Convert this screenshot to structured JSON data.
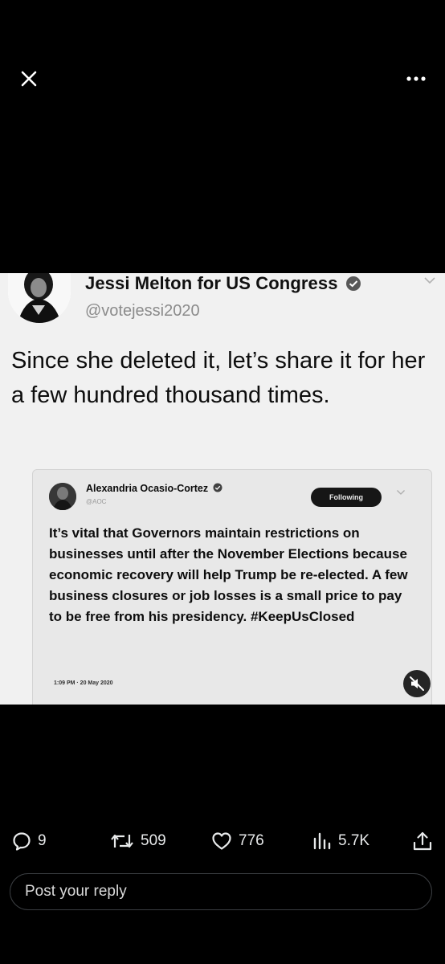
{
  "top_bar": {
    "close_icon": "close-icon",
    "more_icon": "more-options-icon"
  },
  "media": {
    "outer_tweet": {
      "author_name": "Jessi Melton for US Congress",
      "handle": "@votejessi2020",
      "text": "Since she deleted it, let’s share it for her a few hundred thousand times."
    },
    "quoted_tweet": {
      "author_name": "Alexandria Ocasio-Cortez",
      "handle": "@AOC",
      "follow_label": "Following",
      "text": "It’s vital that Governors maintain restrictions on businesses until after the November Elections because economic recovery will help Trump be re-elected. A few business closures or job losses is a small price to pay to be free from his presidency. #KeepUsClosed",
      "timestamp": "1:09 PM · 20 May 2020"
    },
    "mute_icon": "muted-speaker-icon"
  },
  "actions": {
    "replies": "9",
    "reposts": "509",
    "likes": "776",
    "views": "5.7K"
  },
  "reply_box": {
    "placeholder": "Post your reply"
  }
}
